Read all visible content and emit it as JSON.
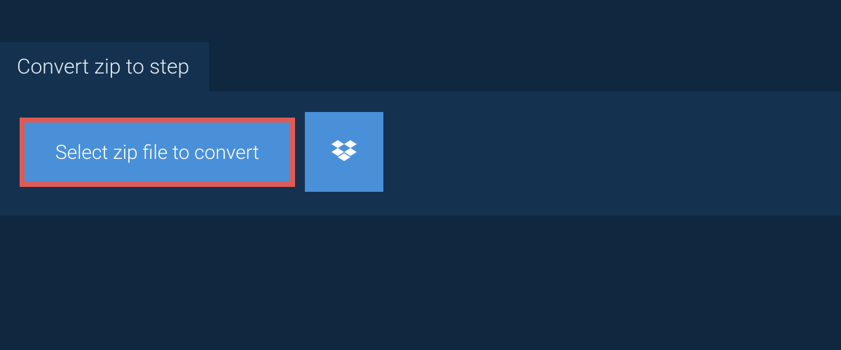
{
  "tab": {
    "title": "Convert zip to step"
  },
  "actions": {
    "select_label": "Select zip file to convert"
  }
}
